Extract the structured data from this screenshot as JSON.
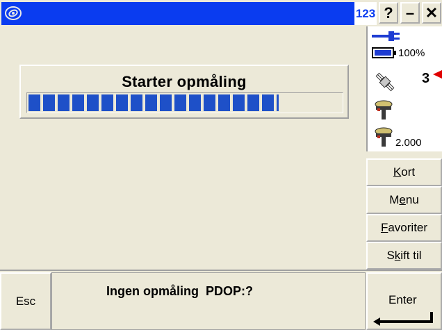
{
  "titlebar": {
    "input_mode": "123",
    "help_label": "?",
    "minimize_label": "–",
    "close_label": "✕"
  },
  "progress": {
    "title": "Starter opmåling",
    "fraction": 0.8
  },
  "status": {
    "battery_percent": "100%",
    "satellite_count": "3",
    "antenna_height": "2.000"
  },
  "sidebar": {
    "buttons": [
      {
        "pre": "",
        "key": "K",
        "post": "ort"
      },
      {
        "pre": "M",
        "key": "e",
        "post": "nu"
      },
      {
        "pre": "",
        "key": "F",
        "post": "avoriter"
      },
      {
        "pre": "S",
        "key": "k",
        "post": "ift til"
      }
    ]
  },
  "bottombar": {
    "esc_label": "Esc",
    "message": "Ingen opmåling  PDOP:?",
    "enter_label": "Enter"
  }
}
